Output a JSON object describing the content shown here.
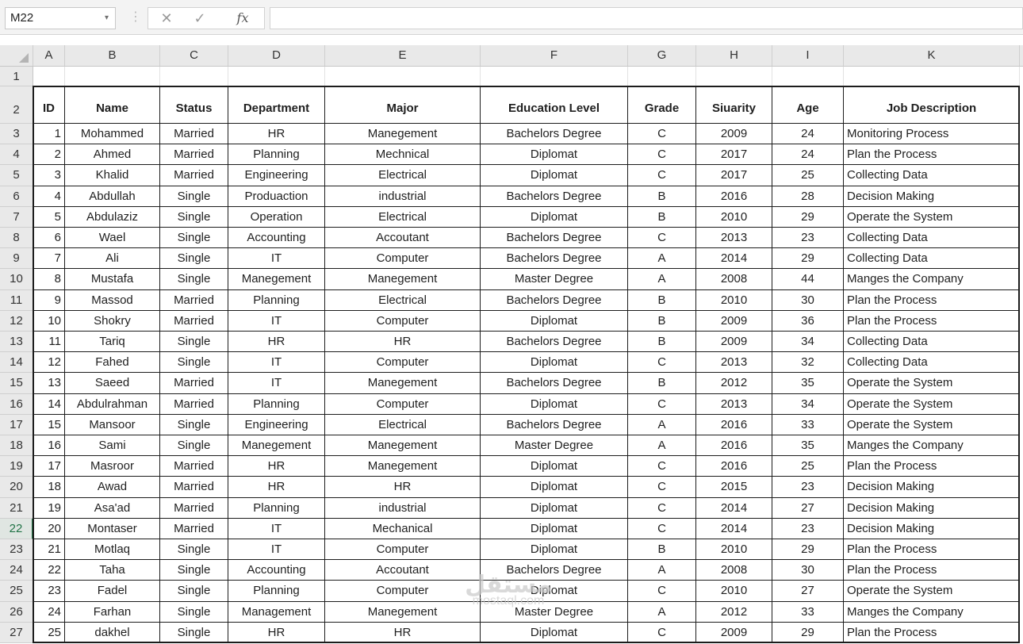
{
  "formula_bar": {
    "name_box": "M22",
    "name_box_arrow": "▾",
    "separator": "⋮",
    "cancel": "✕",
    "enter": "✓",
    "fx": "fx",
    "formula": ""
  },
  "columns": [
    "A",
    "B",
    "C",
    "D",
    "E",
    "F",
    "G",
    "H",
    "I",
    "K"
  ],
  "rows": [
    "1",
    "2",
    "3",
    "4",
    "5",
    "6",
    "7",
    "8",
    "9",
    "10",
    "11",
    "12",
    "13",
    "14",
    "15",
    "16",
    "17",
    "18",
    "19",
    "20",
    "21",
    "22",
    "23",
    "24",
    "25",
    "26",
    "27"
  ],
  "active_row": "22",
  "table": {
    "headers": [
      "ID",
      "Name",
      "Status",
      "Department",
      "Major",
      "Education Level",
      "Grade",
      "Siuarity",
      "Age",
      "Job Description"
    ],
    "records": [
      [
        "1",
        "Mohammed",
        "Married",
        "HR",
        "Manegement",
        "Bachelors Degree",
        "C",
        "2009",
        "24",
        "Monitoring Process"
      ],
      [
        "2",
        "Ahmed",
        "Married",
        "Planning",
        "Mechnical",
        "Diplomat",
        "C",
        "2017",
        "24",
        "Plan the Process"
      ],
      [
        "3",
        "Khalid",
        "Married",
        "Engineering",
        "Electrical",
        "Diplomat",
        "C",
        "2017",
        "25",
        "Collecting Data"
      ],
      [
        "4",
        "Abdullah",
        "Single",
        "Produaction",
        "industrial",
        "Bachelors Degree",
        "B",
        "2016",
        "28",
        "Decision Making"
      ],
      [
        "5",
        "Abdulaziz",
        "Single",
        "Operation",
        "Electrical",
        "Diplomat",
        "B",
        "2010",
        "29",
        "Operate the System"
      ],
      [
        "6",
        "Wael",
        "Single",
        "Accounting",
        "Accoutant",
        "Bachelors Degree",
        "C",
        "2013",
        "23",
        "Collecting Data"
      ],
      [
        "7",
        "Ali",
        "Single",
        "IT",
        "Computer",
        "Bachelors Degree",
        "A",
        "2014",
        "29",
        "Collecting Data"
      ],
      [
        "8",
        "Mustafa",
        "Single",
        "Manegement",
        "Manegement",
        "Master Degree",
        "A",
        "2008",
        "44",
        "Manges the Company"
      ],
      [
        "9",
        "Massod",
        "Married",
        "Planning",
        "Electrical",
        "Bachelors Degree",
        "B",
        "2010",
        "30",
        "Plan the Process"
      ],
      [
        "10",
        "Shokry",
        "Married",
        "IT",
        "Computer",
        "Diplomat",
        "B",
        "2009",
        "36",
        "Plan the Process"
      ],
      [
        "11",
        "Tariq",
        "Single",
        "HR",
        "HR",
        "Bachelors Degree",
        "B",
        "2009",
        "34",
        "Collecting Data"
      ],
      [
        "12",
        "Fahed",
        "Single",
        "IT",
        "Computer",
        "Diplomat",
        "C",
        "2013",
        "32",
        "Collecting Data"
      ],
      [
        "13",
        "Saeed",
        "Married",
        "IT",
        "Manegement",
        "Bachelors Degree",
        "B",
        "2012",
        "35",
        "Operate the System"
      ],
      [
        "14",
        "Abdulrahman",
        "Married",
        "Planning",
        "Computer",
        "Diplomat",
        "C",
        "2013",
        "34",
        "Operate the System"
      ],
      [
        "15",
        "Mansoor",
        "Single",
        "Engineering",
        "Electrical",
        "Bachelors Degree",
        "A",
        "2016",
        "33",
        "Operate the System"
      ],
      [
        "16",
        "Sami",
        "Single",
        "Manegement",
        "Manegement",
        "Master Degree",
        "A",
        "2016",
        "35",
        "Manges the Company"
      ],
      [
        "17",
        "Masroor",
        "Married",
        "HR",
        "Manegement",
        "Diplomat",
        "C",
        "2016",
        "25",
        "Plan the Process"
      ],
      [
        "18",
        "Awad",
        "Married",
        "HR",
        "HR",
        "Diplomat",
        "C",
        "2015",
        "23",
        "Decision Making"
      ],
      [
        "19",
        "Asa'ad",
        "Married",
        "Planning",
        "industrial",
        "Diplomat",
        "C",
        "2014",
        "27",
        "Decision Making"
      ],
      [
        "20",
        "Montaser",
        "Married",
        "IT",
        "Mechanical",
        "Diplomat",
        "C",
        "2014",
        "23",
        "Decision Making"
      ],
      [
        "21",
        "Motlaq",
        "Single",
        "IT",
        "Computer",
        "Diplomat",
        "B",
        "2010",
        "29",
        "Plan the Process"
      ],
      [
        "22",
        "Taha",
        "Single",
        "Accounting",
        "Accoutant",
        "Bachelors Degree",
        "A",
        "2008",
        "30",
        "Plan the Process"
      ],
      [
        "23",
        "Fadel",
        "Single",
        "Planning",
        "Computer",
        "Diplomat",
        "C",
        "2010",
        "27",
        "Operate the System"
      ],
      [
        "24",
        "Farhan",
        "Single",
        "Management",
        "Manegement",
        "Master Degree",
        "A",
        "2012",
        "33",
        "Manges the Company"
      ],
      [
        "25",
        "dakhel",
        "Single",
        "HR",
        "HR",
        "Diplomat",
        "C",
        "2009",
        "29",
        "Plan the Process"
      ]
    ]
  },
  "watermark": {
    "arabic": "مستقل",
    "latin": "mostaql.com"
  },
  "colors": {
    "active_header": "#217346",
    "header_bg": "#e9e9e9",
    "border": "#1c1c1c"
  }
}
